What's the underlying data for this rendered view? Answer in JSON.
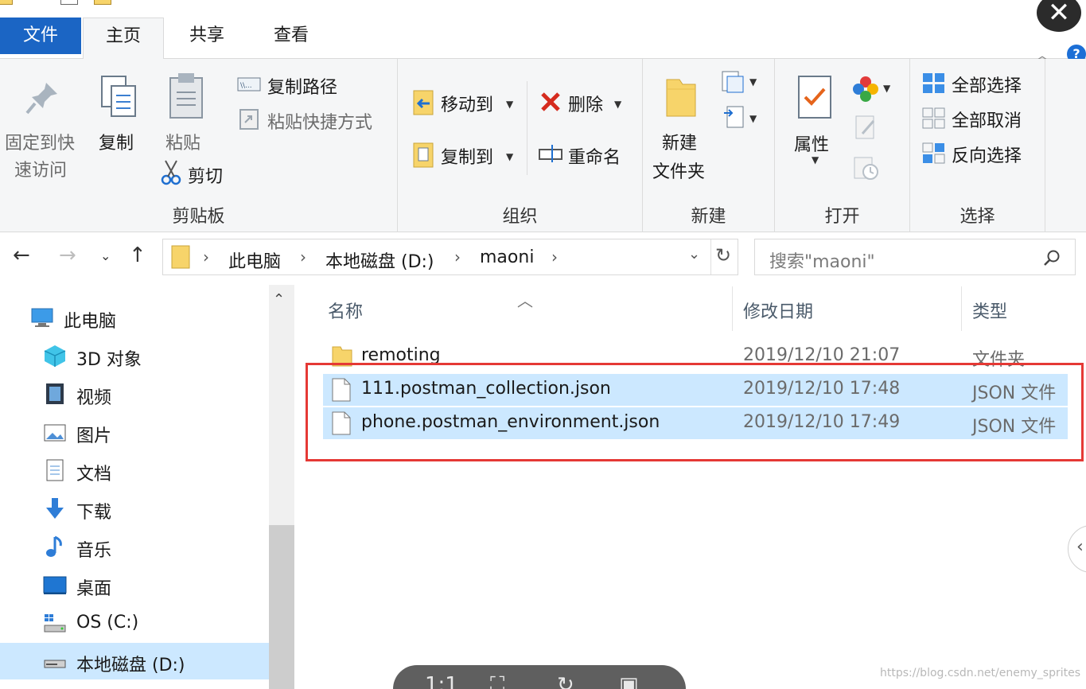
{
  "window": {
    "close_glyph": "✕",
    "help_glyph": "?"
  },
  "ribbon_tabs": [
    {
      "label": "文件"
    },
    {
      "label": "主页"
    },
    {
      "label": "共享"
    },
    {
      "label": "查看"
    }
  ],
  "ribbon": {
    "clipboard": {
      "label": "剪贴板",
      "pin_line1": "固定到快",
      "pin_line2": "速访问",
      "copy": "复制",
      "paste": "粘贴",
      "copy_path": "复制路径",
      "paste_shortcut": "粘贴快捷方式",
      "cut": "剪切"
    },
    "organize": {
      "label": "组织",
      "move_to": "移动到",
      "copy_to": "复制到",
      "delete": "删除",
      "rename": "重命名"
    },
    "new": {
      "label": "新建",
      "new_folder_line1": "新建",
      "new_folder_line2": "文件夹"
    },
    "open": {
      "label": "打开",
      "properties": "属性"
    },
    "select": {
      "label": "选择",
      "select_all": "全部选择",
      "select_none": "全部取消",
      "invert": "反向选择"
    }
  },
  "address": {
    "crumbs": [
      "此电脑",
      "本地磁盘 (D:)",
      "maoni"
    ],
    "search_placeholder": "搜索\"maoni\""
  },
  "nav_pane": {
    "items": [
      {
        "label": "此电脑",
        "icon": "computer-icon"
      },
      {
        "label": "3D 对象",
        "icon": "cube-icon"
      },
      {
        "label": "视频",
        "icon": "video-icon"
      },
      {
        "label": "图片",
        "icon": "picture-icon"
      },
      {
        "label": "文档",
        "icon": "document-icon"
      },
      {
        "label": "下载",
        "icon": "download-icon"
      },
      {
        "label": "音乐",
        "icon": "music-icon"
      },
      {
        "label": "桌面",
        "icon": "desktop-icon"
      },
      {
        "label": "OS (C:)",
        "icon": "drive-icon"
      },
      {
        "label": "本地磁盘 (D:)",
        "icon": "drive-icon"
      }
    ],
    "selected_index": 9
  },
  "file_list": {
    "columns": [
      "名称",
      "修改日期",
      "类型"
    ],
    "rows": [
      {
        "name": "remoting",
        "modified": "2019/12/10 21:07",
        "type": "文件夹",
        "icon": "folder-icon"
      },
      {
        "name": "111.postman_collection.json",
        "modified": "2019/12/10 17:48",
        "type": "JSON 文件",
        "icon": "file-icon"
      },
      {
        "name": "phone.postman_environment.json",
        "modified": "2019/12/10 17:49",
        "type": "JSON 文件",
        "icon": "file-icon"
      }
    ]
  },
  "overlay": {
    "zoom_text": "1:1"
  },
  "watermark": "https://blog.csdn.net/enemy_sprites",
  "colors": {
    "accent": "#1b65c4",
    "selection": "#cce8ff",
    "highlight_box": "#e53935",
    "folder": "#f7d46a"
  }
}
